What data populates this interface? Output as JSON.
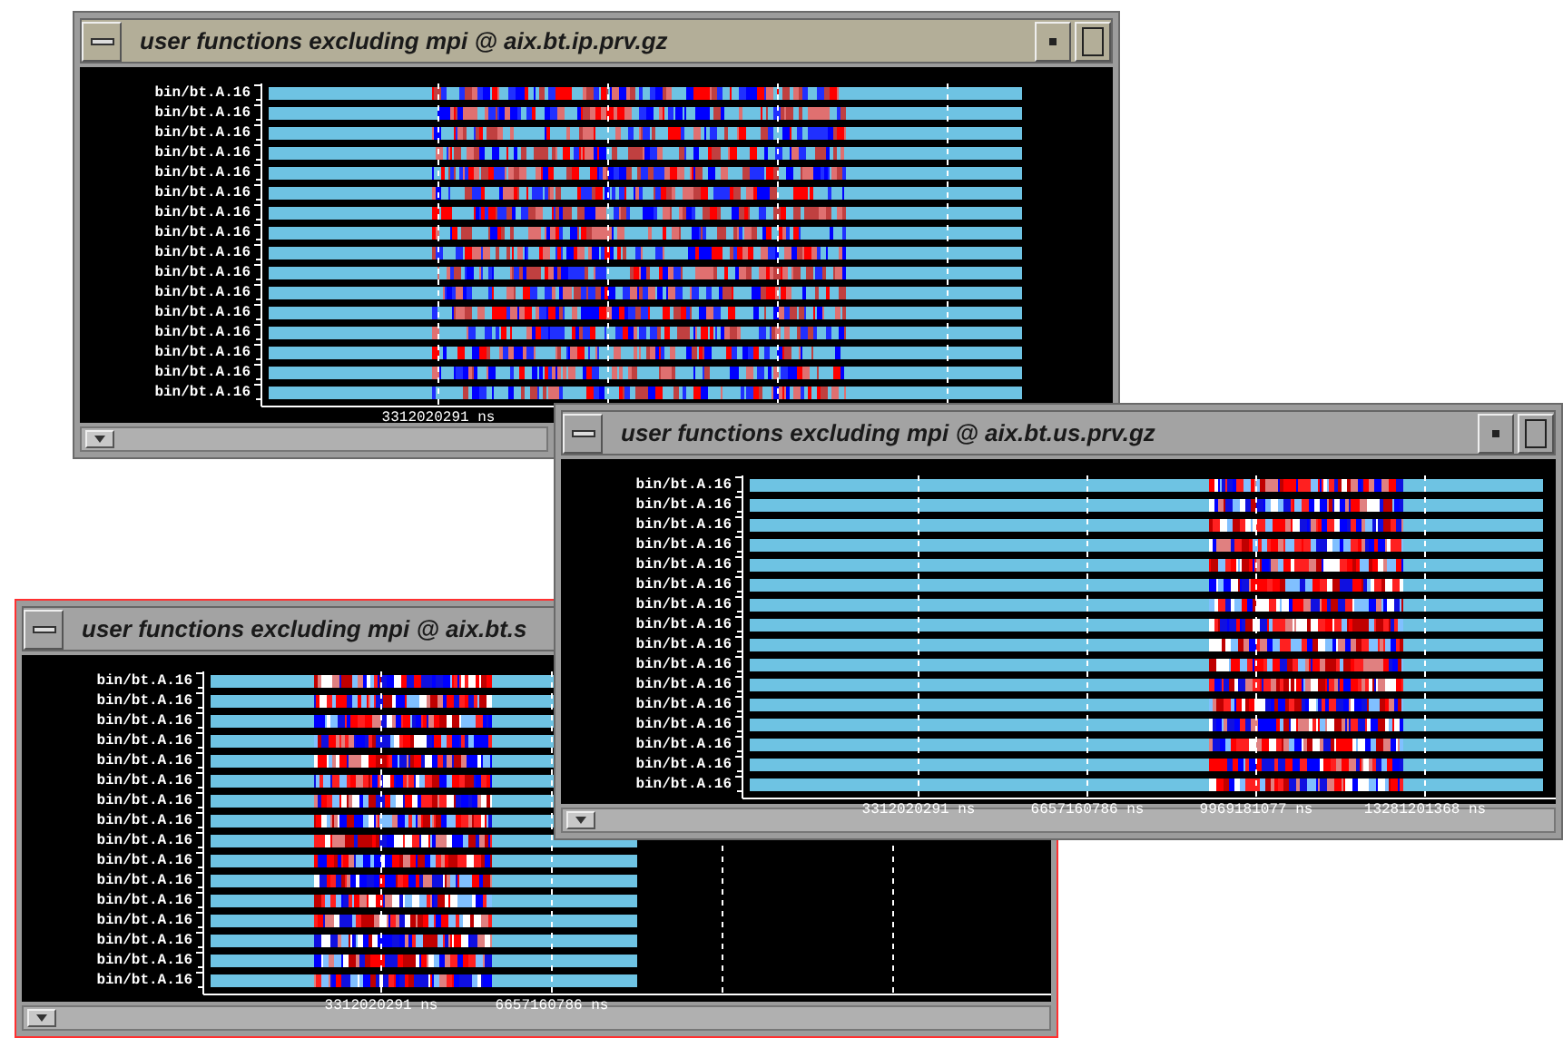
{
  "windows": [
    {
      "title": "user functions excluding mpi @ aix.bt.ip.prv.gz",
      "focused": false,
      "row_labels": [
        "bin/bt.A.16",
        "bin/bt.A.16",
        "bin/bt.A.16",
        "bin/bt.A.16",
        "bin/bt.A.16",
        "bin/bt.A.16",
        "bin/bt.A.16",
        "bin/bt.A.16",
        "bin/bt.A.16",
        "bin/bt.A.16",
        "bin/bt.A.16",
        "bin/bt.A.16",
        "bin/bt.A.16",
        "bin/bt.A.16",
        "bin/bt.A.16",
        "bin/bt.A.16"
      ],
      "tick_labels": [
        "3312020291 ns"
      ]
    },
    {
      "title": "user functions excluding mpi @ aix.bt.s",
      "focused": true,
      "row_labels": [
        "bin/bt.A.16",
        "bin/bt.A.16",
        "bin/bt.A.16",
        "bin/bt.A.16",
        "bin/bt.A.16",
        "bin/bt.A.16",
        "bin/bt.A.16",
        "bin/bt.A.16",
        "bin/bt.A.16",
        "bin/bt.A.16",
        "bin/bt.A.16",
        "bin/bt.A.16",
        "bin/bt.A.16",
        "bin/bt.A.16",
        "bin/bt.A.16",
        "bin/bt.A.16"
      ],
      "tick_labels": [
        "3312020291 ns",
        "6657160786 ns"
      ]
    },
    {
      "title": "user functions excluding mpi @ aix.bt.us.prv.gz",
      "focused": false,
      "row_labels": [
        "bin/bt.A.16",
        "bin/bt.A.16",
        "bin/bt.A.16",
        "bin/bt.A.16",
        "bin/bt.A.16",
        "bin/bt.A.16",
        "bin/bt.A.16",
        "bin/bt.A.16",
        "bin/bt.A.16",
        "bin/bt.A.16",
        "bin/bt.A.16",
        "bin/bt.A.16",
        "bin/bt.A.16",
        "bin/bt.A.16",
        "bin/bt.A.16",
        "bin/bt.A.16"
      ],
      "tick_labels": [
        "3312020291 ns",
        "6657160786 ns",
        "9969181077 ns",
        "13281201368 ns"
      ]
    }
  ]
}
